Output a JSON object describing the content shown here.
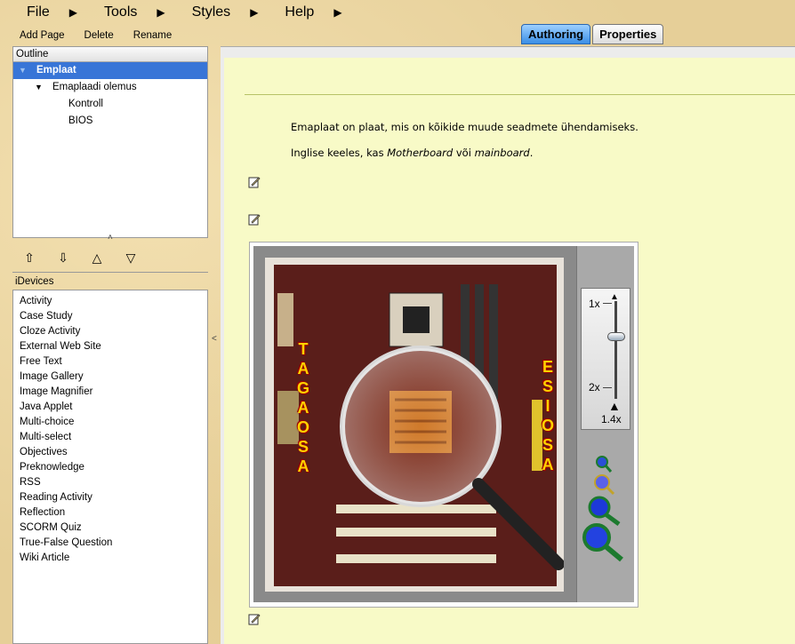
{
  "menu": {
    "file": "File",
    "tools": "Tools",
    "styles": "Styles",
    "help": "Help"
  },
  "page_toolbar": {
    "add_page": "Add Page",
    "delete": "Delete",
    "rename": "Rename"
  },
  "outline": {
    "header": "Outline",
    "items": [
      {
        "label": "Emplaat",
        "expanded": true
      },
      {
        "label": "Emaplaadi olemus",
        "expanded": true
      },
      {
        "label": "Kontroll"
      },
      {
        "label": "BIOS"
      }
    ]
  },
  "idevices": {
    "header": "iDevices",
    "items": [
      "Activity",
      "Case Study",
      "Cloze Activity",
      "External Web Site",
      "Free Text",
      "Image Gallery",
      "Image Magnifier",
      "Java Applet",
      "Multi-choice",
      "Multi-select",
      "Objectives",
      "Preknowledge",
      "RSS",
      "Reading Activity",
      "Reflection",
      "SCORM Quiz",
      "True-False Question",
      "Wiki Article"
    ]
  },
  "tabs": {
    "authoring": "Authoring",
    "properties": "Properties"
  },
  "content": {
    "para1": "Emaplaat on plaat, mis on kõikide muude seadmete ühendamiseks.",
    "para2_prefix": "Inglise keeles, kas ",
    "para2_em1": "Motherboard",
    "para2_mid": " või ",
    "para2_em2": "mainboard",
    "para2_suffix": "."
  },
  "magnifier": {
    "left_text": "TAGAOSA",
    "right_text": "ESIOSA",
    "zoom_min": "1x",
    "zoom_max": "2x",
    "zoom_current": "1.4x",
    "zoom_level": 0.4
  },
  "colors": {
    "selection": "#3875d7",
    "content_bg": "#f8fac7",
    "accent_blue": "#3a8ee6"
  }
}
